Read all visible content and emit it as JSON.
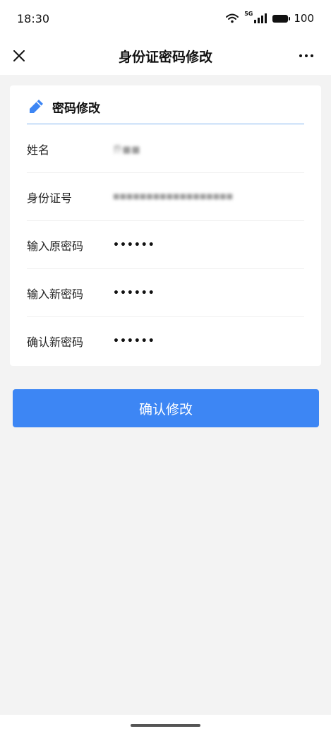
{
  "status_bar": {
    "time": "18:30",
    "network_label": "5G",
    "battery_level": "100"
  },
  "nav": {
    "title": "身份证密码修改",
    "close_icon": "close-icon",
    "more_icon": "more-icon"
  },
  "card": {
    "title": "密码修改",
    "title_icon": "pencil-icon",
    "rows": [
      {
        "label": "姓名",
        "value": "乔■■"
      },
      {
        "label": "身份证号",
        "value": "■■■■■■■■■■■■■■■■■■"
      },
      {
        "label": "输入原密码",
        "value": "••••••"
      },
      {
        "label": "输入新密码",
        "value": "••••••"
      },
      {
        "label": "确认新密码",
        "value": "••••••"
      }
    ]
  },
  "actions": {
    "confirm_label": "确认修改"
  },
  "colors": {
    "accent": "#3d86f4",
    "divider": "#7fb3f0",
    "background": "#f3f3f3"
  }
}
